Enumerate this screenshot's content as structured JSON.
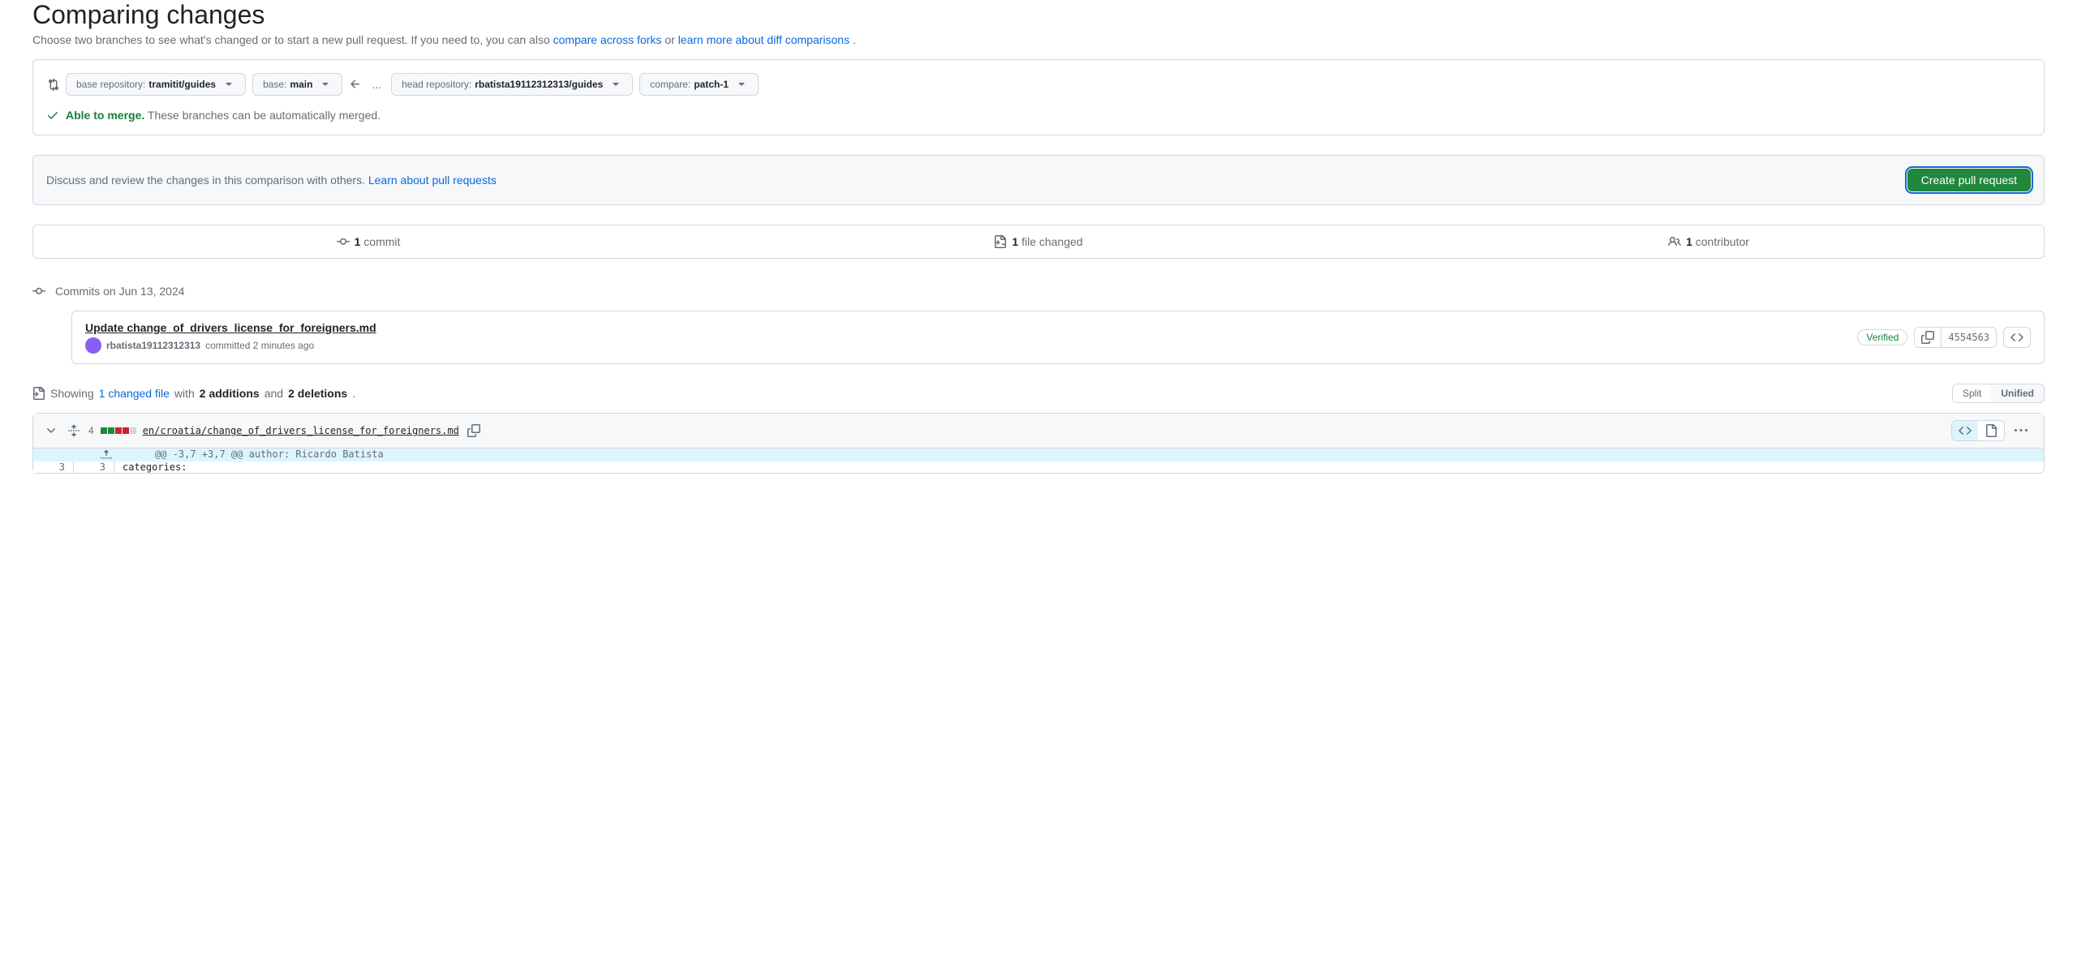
{
  "header": {
    "title": "Comparing changes",
    "subtitle_pre": "Choose two branches to see what's changed or to start a new pull request. If you need to, you can also ",
    "subtitle_link1": "compare across forks",
    "subtitle_mid": " or ",
    "subtitle_link2": "learn more about diff comparisons",
    "subtitle_post": "."
  },
  "selectors": {
    "base_repo_label": "base repository: ",
    "base_repo_value": "tramitit/guides",
    "base_label": "base: ",
    "base_value": "main",
    "head_repo_label": "head repository: ",
    "head_repo_value": "rbatista19112312313/guides",
    "compare_label": "compare: ",
    "compare_value": "patch-1",
    "ellipsis": "..."
  },
  "merge_status": {
    "able": "Able to merge.",
    "detail": " These branches can be automatically merged."
  },
  "discuss": {
    "text": "Discuss and review the changes in this comparison with others. ",
    "link": "Learn about pull requests",
    "button": "Create pull request"
  },
  "stats": {
    "commits_count": "1",
    "commits_label": " commit",
    "files_count": "1",
    "files_label": " file changed",
    "contributors_count": "1",
    "contributors_label": " contributor"
  },
  "commits": {
    "date_header": "Commits on Jun 13, 2024",
    "items": [
      {
        "title": "Update change_of_drivers_license_for_foreigners.md",
        "author": "rbatista19112312313",
        "time": "committed 2 minutes ago",
        "verified": "Verified",
        "sha": "4554563"
      }
    ]
  },
  "diff_summary": {
    "showing": "Showing ",
    "changed_link": "1 changed file",
    "with": " with ",
    "additions": "2 additions",
    "and": " and ",
    "deletions": "2 deletions",
    "period": "."
  },
  "view_toggle": {
    "split": "Split",
    "unified": "Unified"
  },
  "file": {
    "count": "4",
    "path": "en/croatia/change_of_drivers_license_for_foreigners.md",
    "hunk": "@@ -3,7 +3,7 @@ author: Ricardo Batista",
    "line3_left": "3",
    "line3_right": "3",
    "line3_content": "categories:"
  }
}
